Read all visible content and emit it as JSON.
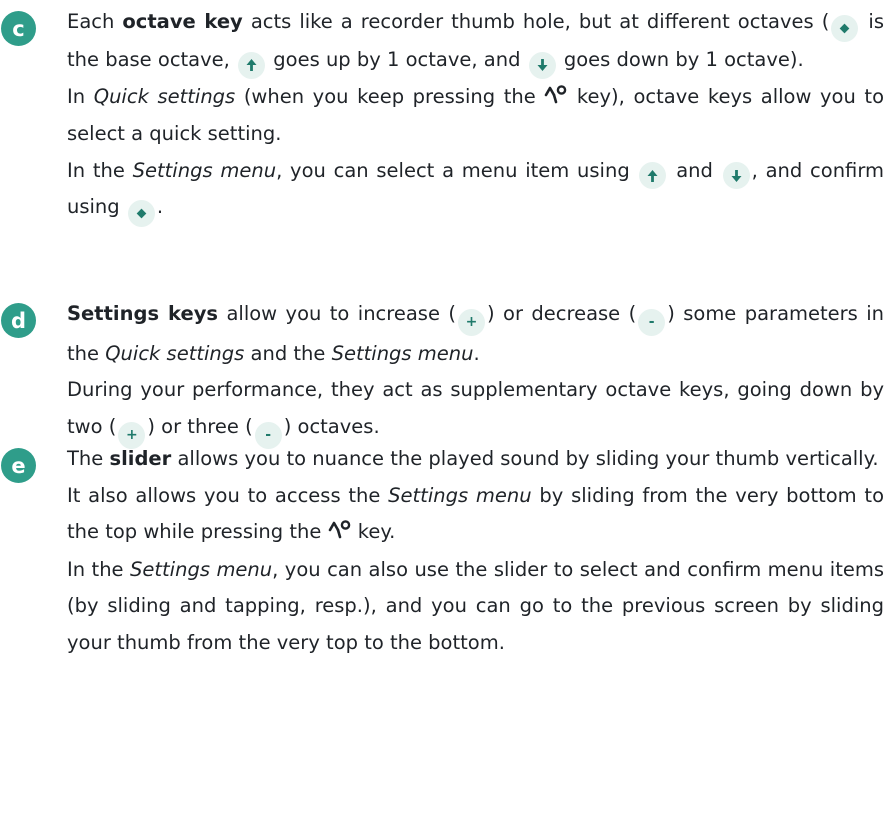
{
  "sections": [
    {
      "letter": "c",
      "p1": {
        "t1": "Each ",
        "b1": "octave key",
        "t2": " acts like a recorder thumb hole, but at different octaves (",
        "t3": " is the base octave, ",
        "t4": " goes up by 1 octave, and ",
        "t5": " goes down by 1 octave)."
      },
      "p2": {
        "t1": "In ",
        "i1": "Quick settings",
        "t2": " (when you keep pressing the ",
        "t3": " key), octave keys allow you to select a quick setting."
      },
      "p3": {
        "t1": "In the ",
        "i1": "Settings menu",
        "t2": ", you can select a menu item using ",
        "t3": " and ",
        "t4": ", and confirm using ",
        "t5": "."
      }
    },
    {
      "letter": "d",
      "p1": {
        "b1": "Settings keys",
        "t1": " allow you to increase (",
        "k_plus": "+",
        "t2": ") or decrease (",
        "k_minus": "-",
        "t3": ") some parameters in the ",
        "i1": "Quick settings",
        "t4": " and the ",
        "i2": "Settings menu",
        "t5": "."
      },
      "p2": {
        "t1": "During your performance, they act as supplementary octave keys, going down by two (",
        "k_plus": "+",
        "t2": ") or three (",
        "k_minus": "-",
        "t3": ") octaves."
      }
    },
    {
      "letter": "e",
      "p1": {
        "t1": "The ",
        "b1": "slider",
        "t2": " allows you to nuance the played sound by sliding your thumb vertically."
      },
      "p2": {
        "t1": "It also allows you to access the ",
        "i1": "Settings menu",
        "t2": " by sliding from the very bottom to the top while pressing the ",
        "t3": " key."
      },
      "p3": {
        "t1": "In the ",
        "i1": "Settings menu",
        "t2": ", you can also use the slider to select and confirm menu items (by sliding and tapping, resp.), and you can go to the previous screen by sliding your thumb from the very top to the bottom."
      }
    }
  ],
  "icons": {
    "base_octave": "diamond-icon",
    "octave_up": "arrow-up-icon",
    "octave_down": "arrow-down-icon",
    "function_key": "function-key-glyph-icon"
  },
  "colors": {
    "badge": "#2f9d8a",
    "key_bg": "#e6f2ef",
    "key_fg": "#1f7a6b",
    "text": "#1f2328"
  }
}
